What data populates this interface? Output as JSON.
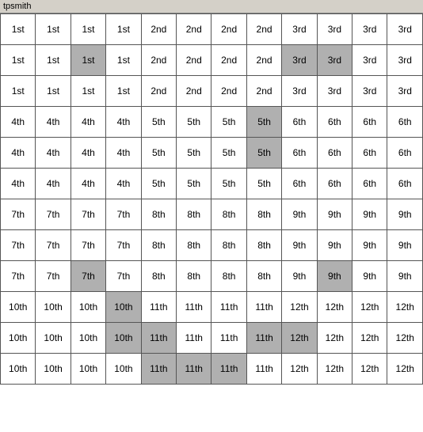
{
  "title": "tpsmith",
  "rows": [
    [
      {
        "text": "1st",
        "hl": false
      },
      {
        "text": "1st",
        "hl": false
      },
      {
        "text": "1st",
        "hl": false
      },
      {
        "text": "1st",
        "hl": false
      },
      {
        "text": "2nd",
        "hl": false
      },
      {
        "text": "2nd",
        "hl": false
      },
      {
        "text": "2nd",
        "hl": false
      },
      {
        "text": "2nd",
        "hl": false
      },
      {
        "text": "3rd",
        "hl": false
      },
      {
        "text": "3rd",
        "hl": false
      },
      {
        "text": "3rd",
        "hl": false
      },
      {
        "text": "3rd",
        "hl": false
      }
    ],
    [
      {
        "text": "1st",
        "hl": false
      },
      {
        "text": "1st",
        "hl": false
      },
      {
        "text": "1st",
        "hl": true
      },
      {
        "text": "1st",
        "hl": false
      },
      {
        "text": "2nd",
        "hl": false
      },
      {
        "text": "2nd",
        "hl": false
      },
      {
        "text": "2nd",
        "hl": false
      },
      {
        "text": "2nd",
        "hl": false
      },
      {
        "text": "3rd",
        "hl": true
      },
      {
        "text": "3rd",
        "hl": true
      },
      {
        "text": "3rd",
        "hl": false
      },
      {
        "text": "3rd",
        "hl": false
      }
    ],
    [
      {
        "text": "1st",
        "hl": false
      },
      {
        "text": "1st",
        "hl": false
      },
      {
        "text": "1st",
        "hl": false
      },
      {
        "text": "1st",
        "hl": false
      },
      {
        "text": "2nd",
        "hl": false
      },
      {
        "text": "2nd",
        "hl": false
      },
      {
        "text": "2nd",
        "hl": false
      },
      {
        "text": "2nd",
        "hl": false
      },
      {
        "text": "3rd",
        "hl": false
      },
      {
        "text": "3rd",
        "hl": false
      },
      {
        "text": "3rd",
        "hl": false
      },
      {
        "text": "3rd",
        "hl": false
      }
    ],
    [
      {
        "text": "4th",
        "hl": false
      },
      {
        "text": "4th",
        "hl": false
      },
      {
        "text": "4th",
        "hl": false
      },
      {
        "text": "4th",
        "hl": false
      },
      {
        "text": "5th",
        "hl": false
      },
      {
        "text": "5th",
        "hl": false
      },
      {
        "text": "5th",
        "hl": false
      },
      {
        "text": "5th",
        "hl": true
      },
      {
        "text": "6th",
        "hl": false
      },
      {
        "text": "6th",
        "hl": false
      },
      {
        "text": "6th",
        "hl": false
      },
      {
        "text": "6th",
        "hl": false
      }
    ],
    [
      {
        "text": "4th",
        "hl": false
      },
      {
        "text": "4th",
        "hl": false
      },
      {
        "text": "4th",
        "hl": false
      },
      {
        "text": "4th",
        "hl": false
      },
      {
        "text": "5th",
        "hl": false
      },
      {
        "text": "5th",
        "hl": false
      },
      {
        "text": "5th",
        "hl": false
      },
      {
        "text": "5th",
        "hl": true
      },
      {
        "text": "6th",
        "hl": false
      },
      {
        "text": "6th",
        "hl": false
      },
      {
        "text": "6th",
        "hl": false
      },
      {
        "text": "6th",
        "hl": false
      }
    ],
    [
      {
        "text": "4th",
        "hl": false
      },
      {
        "text": "4th",
        "hl": false
      },
      {
        "text": "4th",
        "hl": false
      },
      {
        "text": "4th",
        "hl": false
      },
      {
        "text": "5th",
        "hl": false
      },
      {
        "text": "5th",
        "hl": false
      },
      {
        "text": "5th",
        "hl": false
      },
      {
        "text": "5th",
        "hl": false
      },
      {
        "text": "6th",
        "hl": false
      },
      {
        "text": "6th",
        "hl": false
      },
      {
        "text": "6th",
        "hl": false
      },
      {
        "text": "6th",
        "hl": false
      }
    ],
    [
      {
        "text": "7th",
        "hl": false
      },
      {
        "text": "7th",
        "hl": false
      },
      {
        "text": "7th",
        "hl": false
      },
      {
        "text": "7th",
        "hl": false
      },
      {
        "text": "8th",
        "hl": false
      },
      {
        "text": "8th",
        "hl": false
      },
      {
        "text": "8th",
        "hl": false
      },
      {
        "text": "8th",
        "hl": false
      },
      {
        "text": "9th",
        "hl": false
      },
      {
        "text": "9th",
        "hl": false
      },
      {
        "text": "9th",
        "hl": false
      },
      {
        "text": "9th",
        "hl": false
      }
    ],
    [
      {
        "text": "7th",
        "hl": false
      },
      {
        "text": "7th",
        "hl": false
      },
      {
        "text": "7th",
        "hl": false
      },
      {
        "text": "7th",
        "hl": false
      },
      {
        "text": "8th",
        "hl": false
      },
      {
        "text": "8th",
        "hl": false
      },
      {
        "text": "8th",
        "hl": false
      },
      {
        "text": "8th",
        "hl": false
      },
      {
        "text": "9th",
        "hl": false
      },
      {
        "text": "9th",
        "hl": false
      },
      {
        "text": "9th",
        "hl": false
      },
      {
        "text": "9th",
        "hl": false
      }
    ],
    [
      {
        "text": "7th",
        "hl": false
      },
      {
        "text": "7th",
        "hl": false
      },
      {
        "text": "7th",
        "hl": true
      },
      {
        "text": "7th",
        "hl": false
      },
      {
        "text": "8th",
        "hl": false
      },
      {
        "text": "8th",
        "hl": false
      },
      {
        "text": "8th",
        "hl": false
      },
      {
        "text": "8th",
        "hl": false
      },
      {
        "text": "9th",
        "hl": false
      },
      {
        "text": "9th",
        "hl": true
      },
      {
        "text": "9th",
        "hl": false
      },
      {
        "text": "9th",
        "hl": false
      }
    ],
    [
      {
        "text": "10th",
        "hl": false
      },
      {
        "text": "10th",
        "hl": false
      },
      {
        "text": "10th",
        "hl": false
      },
      {
        "text": "10th",
        "hl": true
      },
      {
        "text": "11th",
        "hl": false
      },
      {
        "text": "11th",
        "hl": false
      },
      {
        "text": "11th",
        "hl": false
      },
      {
        "text": "11th",
        "hl": false
      },
      {
        "text": "12th",
        "hl": false
      },
      {
        "text": "12th",
        "hl": false
      },
      {
        "text": "12th",
        "hl": false
      },
      {
        "text": "12th",
        "hl": false
      }
    ],
    [
      {
        "text": "10th",
        "hl": false
      },
      {
        "text": "10th",
        "hl": false
      },
      {
        "text": "10th",
        "hl": false
      },
      {
        "text": "10th",
        "hl": true
      },
      {
        "text": "11th",
        "hl": true
      },
      {
        "text": "11th",
        "hl": false
      },
      {
        "text": "11th",
        "hl": false
      },
      {
        "text": "11th",
        "hl": true
      },
      {
        "text": "12th",
        "hl": true
      },
      {
        "text": "12th",
        "hl": false
      },
      {
        "text": "12th",
        "hl": false
      },
      {
        "text": "12th",
        "hl": false
      }
    ],
    [
      {
        "text": "10th",
        "hl": false
      },
      {
        "text": "10th",
        "hl": false
      },
      {
        "text": "10th",
        "hl": false
      },
      {
        "text": "10th",
        "hl": false
      },
      {
        "text": "11th",
        "hl": true
      },
      {
        "text": "11th",
        "hl": true
      },
      {
        "text": "11th",
        "hl": true
      },
      {
        "text": "11th",
        "hl": false
      },
      {
        "text": "12th",
        "hl": false
      },
      {
        "text": "12th",
        "hl": false
      },
      {
        "text": "12th",
        "hl": false
      },
      {
        "text": "12th",
        "hl": false
      }
    ]
  ]
}
